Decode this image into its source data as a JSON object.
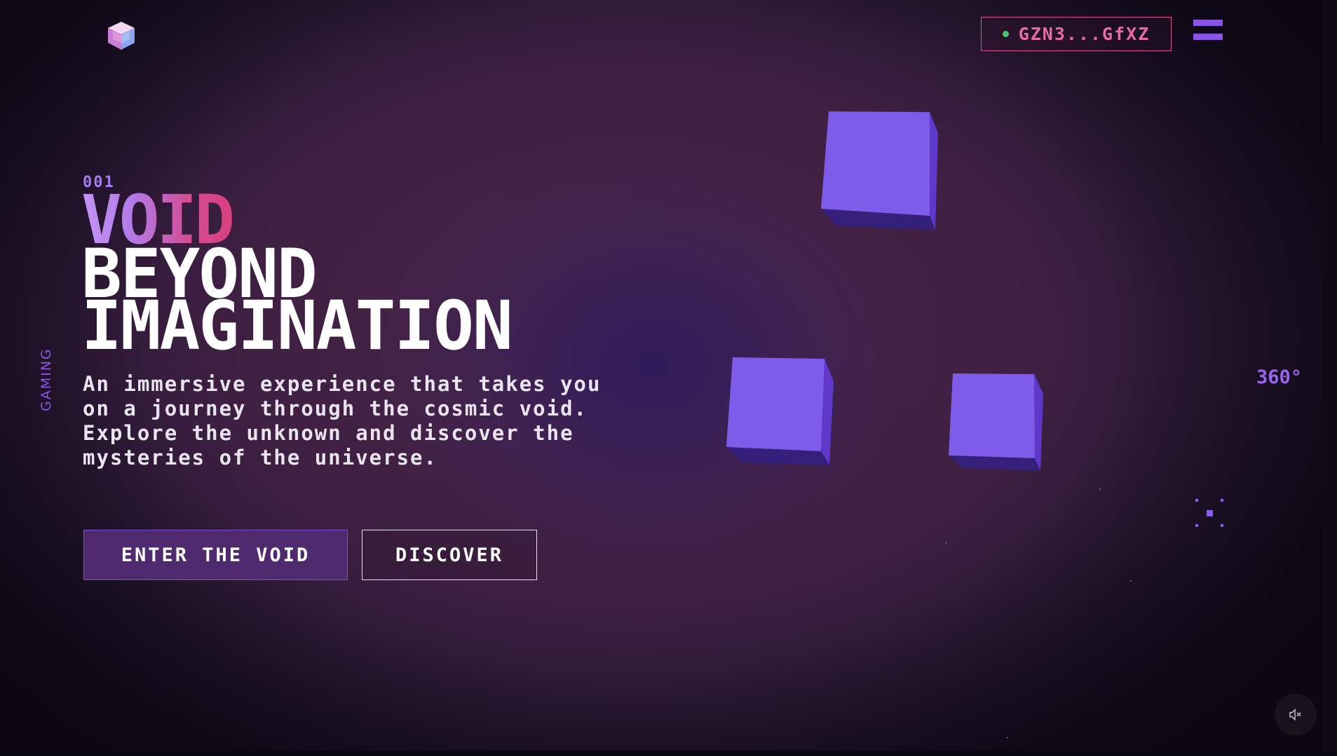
{
  "header": {
    "logo_icon": "cube-logo-icon",
    "wallet": {
      "status_color": "#4fc36b",
      "address": "GZN3...GfXZ"
    },
    "menu_icon": "hamburger-menu-icon"
  },
  "side_label": "GAMING",
  "hero": {
    "index": "001",
    "title_accent": "VOID",
    "title_line_2": "BEYOND",
    "title_line_3": "IMAGINATION",
    "description": "An immersive experience that takes you on a journey through the cosmic void. Explore the unknown and discover the mysteries of the universe.",
    "primary_button": "ENTER THE VOID",
    "secondary_button": "DISCOVER"
  },
  "rotation_label": "360°",
  "sound": {
    "icon": "muted-speaker-icon"
  },
  "colors": {
    "accent_purple": "#8b5cf6",
    "accent_pink": "#d9548f",
    "cube_face": "#7f5bea"
  }
}
